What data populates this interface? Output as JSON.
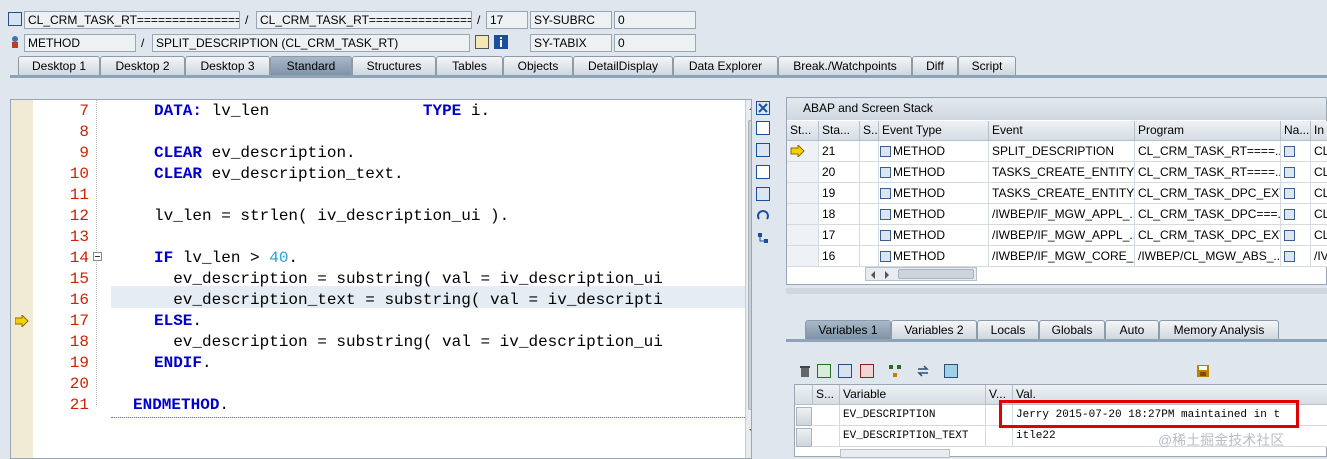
{
  "header": {
    "row1": {
      "class_left": "CL_CRM_TASK_RT===============",
      "class_right": "CL_CRM_TASK_RT===============",
      "line": "17",
      "sysvar_name": "SY-SUBRC",
      "sysvar_value": "0"
    },
    "row2": {
      "event_type": "METHOD",
      "event": "SPLIT_DESCRIPTION (CL_CRM_TASK_RT)",
      "sysvar_name": "SY-TABIX",
      "sysvar_value": "0"
    },
    "sep_slash": "/"
  },
  "tabs": [
    {
      "label": "Desktop 1"
    },
    {
      "label": "Desktop 2"
    },
    {
      "label": "Desktop 3"
    },
    {
      "label": "Standard"
    },
    {
      "label": "Structures"
    },
    {
      "label": "Tables"
    },
    {
      "label": "Objects"
    },
    {
      "label": "DetailDisplay"
    },
    {
      "label": "Data Explorer"
    },
    {
      "label": "Break./Watchpoints"
    },
    {
      "label": "Diff"
    },
    {
      "label": "Script"
    }
  ],
  "code": {
    "lines": [
      {
        "num": "7"
      },
      {
        "num": "8"
      },
      {
        "num": "9"
      },
      {
        "num": "10"
      },
      {
        "num": "11"
      },
      {
        "num": "12"
      },
      {
        "num": "13"
      },
      {
        "num": "14"
      },
      {
        "num": "15"
      },
      {
        "num": "16"
      },
      {
        "num": "17"
      },
      {
        "num": "18"
      },
      {
        "num": "19"
      },
      {
        "num": "20"
      },
      {
        "num": "21"
      }
    ],
    "t": {
      "data_kw": "DATA:",
      "data_rest": " lv_len                ",
      "type_kw": "TYPE",
      "type_rest": " i.",
      "clear_kw": "CLEAR",
      "clear1_rest": " ev_description.",
      "clear2_rest": " ev_description_text.",
      "l12": "lv_len = strlen( iv_description_ui ).",
      "if_kw": "IF",
      "if_rest": " lv_len > ",
      "if_num": "40",
      "if_end": ".",
      "l15": "  ev_description = substring( val = iv_description_ui",
      "l16": "  ev_description_text = substring( val = iv_descripti",
      "else_kw": "ELSE",
      "else_end": ".",
      "l18": "  ev_description = substring( val = iv_description_ui",
      "endif_kw": "ENDIF",
      "endif_end": ".",
      "endmethod_kw": "ENDMETHOD",
      "endmethod_end": "."
    }
  },
  "stack": {
    "title": "ABAP and Screen Stack",
    "columns": [
      "St...",
      "Sta...",
      "S...",
      "Event Type",
      "Event",
      "Program",
      "Na...",
      "In"
    ],
    "rows": [
      {
        "level": "21",
        "type": "METHOD",
        "event": "SPLIT_DESCRIPTION",
        "program": "CL_CRM_TASK_RT====...",
        "inc": "CL"
      },
      {
        "level": "20",
        "type": "METHOD",
        "event": "TASKS_CREATE_ENTITY",
        "program": "CL_CRM_TASK_RT====...",
        "inc": "CL"
      },
      {
        "level": "19",
        "type": "METHOD",
        "event": "TASKS_CREATE_ENTITY",
        "program": "CL_CRM_TASK_DPC_EXT...",
        "inc": "CL"
      },
      {
        "level": "18",
        "type": "METHOD",
        "event": "/IWBEP/IF_MGW_APPL_...",
        "program": "CL_CRM_TASK_DPC===...",
        "inc": "CL"
      },
      {
        "level": "17",
        "type": "METHOD",
        "event": "/IWBEP/IF_MGW_APPL_...",
        "program": "CL_CRM_TASK_DPC_EXT...",
        "inc": "CL"
      },
      {
        "level": "16",
        "type": "METHOD",
        "event": "/IWBEP/IF_MGW_CORE_...",
        "program": "/IWBEP/CL_MGW_ABS_...",
        "inc": "/IV"
      }
    ]
  },
  "var_tabs": [
    {
      "label": "Variables 1"
    },
    {
      "label": "Variables 2"
    },
    {
      "label": "Locals"
    },
    {
      "label": "Globals"
    },
    {
      "label": "Auto"
    },
    {
      "label": "Memory Analysis"
    }
  ],
  "vars": {
    "columns": [
      "S...",
      "Variable",
      "V...",
      "Val."
    ],
    "rows": [
      {
        "name": "EV_DESCRIPTION",
        "value": "Jerry 2015-07-20 18:27PM maintained in t"
      },
      {
        "name": "EV_DESCRIPTION_TEXT",
        "value": "itle22"
      }
    ]
  },
  "colors": {
    "highlight_border": "#e00000",
    "active_tab": "#8fa3b8",
    "line_number": "#cc2200",
    "keyword": "#0000cc"
  },
  "watermark": "@稀土掘金技术社区"
}
